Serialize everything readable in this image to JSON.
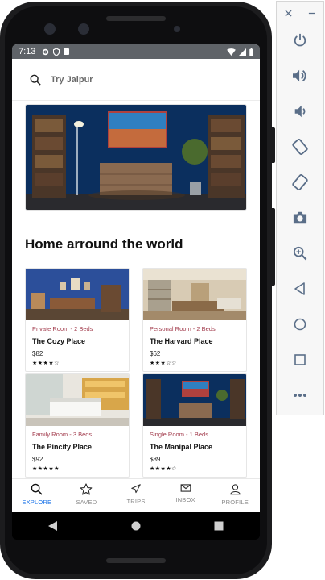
{
  "status_bar": {
    "time": "7:13"
  },
  "search": {
    "placeholder": "Try Jaipur"
  },
  "section": {
    "title": "Home arround the world"
  },
  "listings": [
    {
      "type": "Private Room - 2 Beds",
      "title": "The Cozy Place",
      "price": "$82",
      "rating": 4,
      "stars": "★★★★☆"
    },
    {
      "type": "Personal Room - 2 Beds",
      "title": "The Harvard Place",
      "price": "$62",
      "rating": 3,
      "stars": "★★★☆☆"
    },
    {
      "type": "Family Room - 3 Beds",
      "title": "The Pincity Place",
      "price": "$92",
      "rating": 5,
      "stars": "★★★★★"
    },
    {
      "type": "Single Room - 1 Beds",
      "title": "The Manipal Place",
      "price": "$89",
      "rating": 4,
      "stars": "★★★★☆"
    }
  ],
  "bottom_nav": [
    {
      "label": "EXPLORE",
      "icon": "search-icon",
      "active": true
    },
    {
      "label": "SAVED",
      "icon": "star-outline-icon",
      "active": false
    },
    {
      "label": "TRIPS",
      "icon": "airplane-icon",
      "active": false
    },
    {
      "label": "INBOX",
      "icon": "mail-icon",
      "active": false
    },
    {
      "label": "PROFILE",
      "icon": "person-icon",
      "active": false
    }
  ],
  "emulator_panel": {
    "window_controls": [
      "close-icon",
      "minimize-icon"
    ],
    "buttons": [
      "power-icon",
      "volume-up-icon",
      "volume-down-icon",
      "rotate-left-icon",
      "rotate-right-icon",
      "camera-icon",
      "zoom-icon",
      "back-icon",
      "home-icon",
      "overview-icon",
      "more-icon"
    ]
  },
  "colors": {
    "accent": "#1a73e8",
    "room_type": "#a23b4c",
    "status_bar": "#5f6368",
    "phone_frame": "#1c1c1e"
  }
}
